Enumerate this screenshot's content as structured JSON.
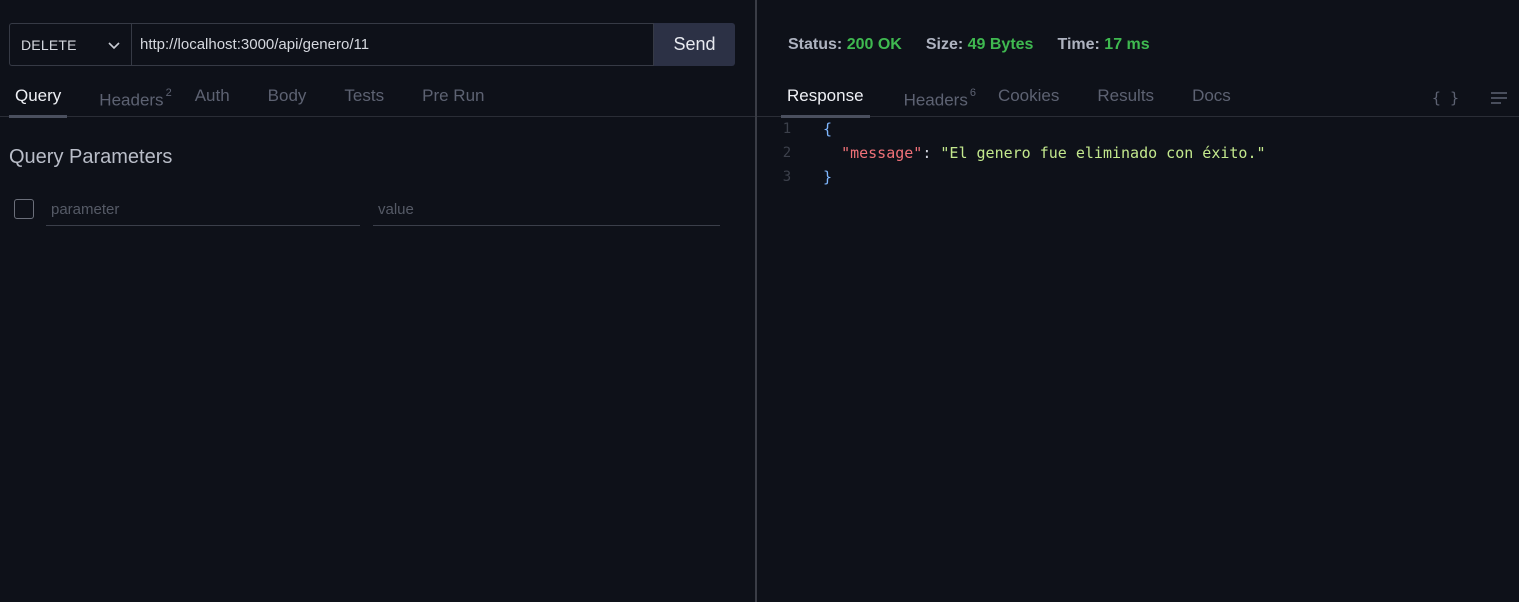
{
  "request": {
    "method": "DELETE",
    "url": "http://localhost:3000/api/genero/11",
    "send_label": "Send"
  },
  "left_tabs": [
    {
      "label": "Query",
      "badge": ""
    },
    {
      "label": "Headers",
      "badge": "2"
    },
    {
      "label": "Auth",
      "badge": ""
    },
    {
      "label": "Body",
      "badge": ""
    },
    {
      "label": "Tests",
      "badge": ""
    },
    {
      "label": "Pre Run",
      "badge": ""
    }
  ],
  "query": {
    "title": "Query Parameters",
    "param_placeholder": "parameter",
    "value_placeholder": "value"
  },
  "status": {
    "status_label": "Status:",
    "status_value": "200 OK",
    "size_label": "Size:",
    "size_value": "49 Bytes",
    "time_label": "Time:",
    "time_value": "17 ms"
  },
  "right_tabs": [
    {
      "label": "Response",
      "badge": ""
    },
    {
      "label": "Headers",
      "badge": "6"
    },
    {
      "label": "Cookies",
      "badge": ""
    },
    {
      "label": "Results",
      "badge": ""
    },
    {
      "label": "Docs",
      "badge": ""
    }
  ],
  "response": {
    "lines": [
      {
        "no": "1",
        "open": "{"
      },
      {
        "no": "2",
        "key": "\"message\"",
        "colon": ": ",
        "value": "\"El genero fue eliminado con éxito.\""
      },
      {
        "no": "3",
        "close": "}"
      }
    ],
    "braces_icon": "{ }"
  },
  "colors": {
    "background": "#0e1119",
    "accent_green": "#3fb950",
    "send_button": "#2c3145",
    "json_key": "#f07178",
    "json_string": "#c3e88d"
  },
  "icons": [
    "chevron-down-icon",
    "braces-icon",
    "wrap-lines-icon",
    "checkbox-icon"
  ]
}
